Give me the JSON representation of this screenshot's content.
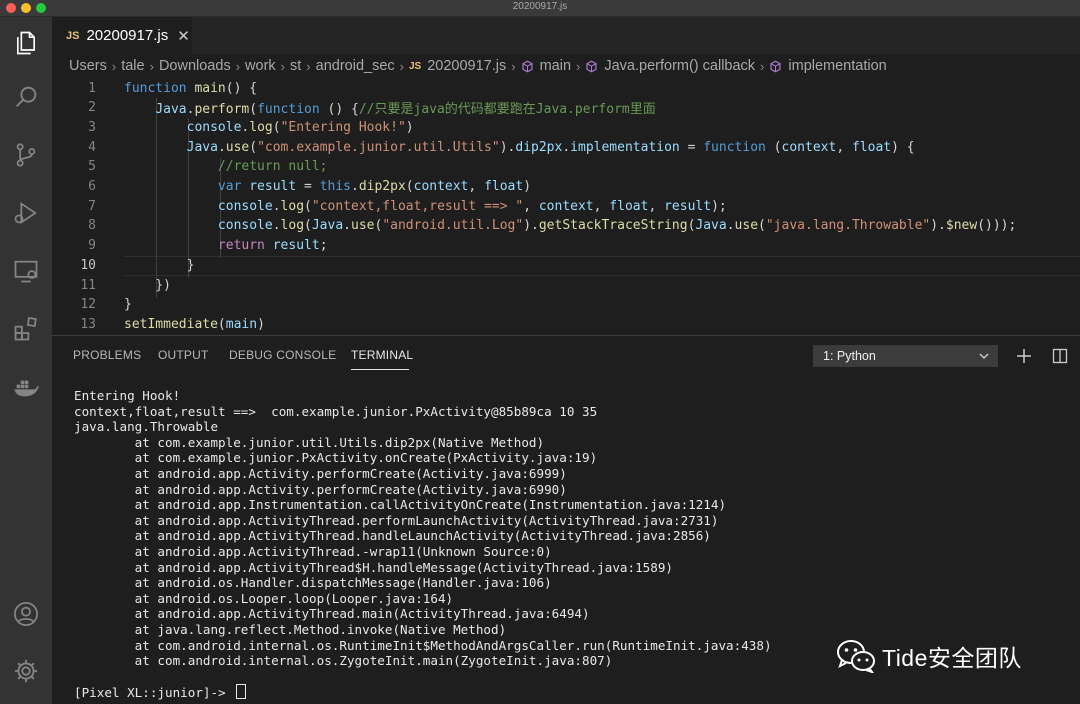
{
  "window": {
    "title": "20200917.js"
  },
  "activity_bar": {
    "icons": [
      "files-icon",
      "search-icon",
      "source-control-icon",
      "run-debug-icon",
      "remote-explorer-icon",
      "extensions-icon",
      "docker-icon",
      "account-icon",
      "settings-gear-icon"
    ]
  },
  "tab": {
    "badge": "JS",
    "name": "20200917.js",
    "close": "✕"
  },
  "breadcrumb": {
    "items": [
      "Users",
      "tale",
      "Downloads",
      "work",
      "st",
      "android_sec"
    ],
    "file_badge": "JS",
    "file": "20200917.js",
    "symbols": [
      "main",
      "Java.perform() callback",
      "implementation"
    ]
  },
  "editor": {
    "current_line": 10,
    "lines": [
      {
        "n": "1",
        "tokens": [
          [
            "k",
            "function"
          ],
          [
            "p",
            " "
          ],
          [
            "f",
            "main"
          ],
          [
            "p",
            "() {"
          ]
        ]
      },
      {
        "n": "2",
        "tokens": [
          [
            "p",
            "    "
          ],
          [
            "v",
            "Java"
          ],
          [
            "p",
            "."
          ],
          [
            "f",
            "perform"
          ],
          [
            "p",
            "("
          ],
          [
            "k",
            "function"
          ],
          [
            "p",
            " () {"
          ],
          [
            "c",
            "//只要是java的代码都要跑在Java.perform里面"
          ]
        ]
      },
      {
        "n": "3",
        "tokens": [
          [
            "p",
            "        "
          ],
          [
            "v",
            "console"
          ],
          [
            "p",
            "."
          ],
          [
            "f",
            "log"
          ],
          [
            "p",
            "("
          ],
          [
            "s",
            "\"Entering Hook!\""
          ],
          [
            "p",
            ")"
          ]
        ]
      },
      {
        "n": "4",
        "tokens": [
          [
            "p",
            "        "
          ],
          [
            "v",
            "Java"
          ],
          [
            "p",
            "."
          ],
          [
            "f",
            "use"
          ],
          [
            "p",
            "("
          ],
          [
            "s",
            "\"com.example.junior.util.Utils\""
          ],
          [
            "p",
            ")."
          ],
          [
            "v",
            "dip2px"
          ],
          [
            "p",
            "."
          ],
          [
            "v",
            "implementation"
          ],
          [
            "p",
            " = "
          ],
          [
            "k",
            "function"
          ],
          [
            "p",
            " ("
          ],
          [
            "v",
            "context"
          ],
          [
            "p",
            ", "
          ],
          [
            "v",
            "float"
          ],
          [
            "p",
            ") {"
          ]
        ]
      },
      {
        "n": "5",
        "tokens": [
          [
            "p",
            "            "
          ],
          [
            "c",
            "//return null;"
          ]
        ]
      },
      {
        "n": "6",
        "tokens": [
          [
            "p",
            "            "
          ],
          [
            "k",
            "var"
          ],
          [
            "p",
            " "
          ],
          [
            "v",
            "result"
          ],
          [
            "p",
            " = "
          ],
          [
            "k",
            "this"
          ],
          [
            "p",
            "."
          ],
          [
            "f",
            "dip2px"
          ],
          [
            "p",
            "("
          ],
          [
            "v",
            "context"
          ],
          [
            "p",
            ", "
          ],
          [
            "v",
            "float"
          ],
          [
            "p",
            ")"
          ]
        ]
      },
      {
        "n": "7",
        "tokens": [
          [
            "p",
            "            "
          ],
          [
            "v",
            "console"
          ],
          [
            "p",
            "."
          ],
          [
            "f",
            "log"
          ],
          [
            "p",
            "("
          ],
          [
            "s",
            "\"context,float,result ==> \""
          ],
          [
            "p",
            ", "
          ],
          [
            "v",
            "context"
          ],
          [
            "p",
            ", "
          ],
          [
            "v",
            "float"
          ],
          [
            "p",
            ", "
          ],
          [
            "v",
            "result"
          ],
          [
            "p",
            ");"
          ]
        ]
      },
      {
        "n": "8",
        "tokens": [
          [
            "p",
            "            "
          ],
          [
            "v",
            "console"
          ],
          [
            "p",
            "."
          ],
          [
            "f",
            "log"
          ],
          [
            "p",
            "("
          ],
          [
            "v",
            "Java"
          ],
          [
            "p",
            "."
          ],
          [
            "f",
            "use"
          ],
          [
            "p",
            "("
          ],
          [
            "s",
            "\"android.util.Log\""
          ],
          [
            "p",
            ")."
          ],
          [
            "f",
            "getStackTraceString"
          ],
          [
            "p",
            "("
          ],
          [
            "v",
            "Java"
          ],
          [
            "p",
            "."
          ],
          [
            "f",
            "use"
          ],
          [
            "p",
            "("
          ],
          [
            "s",
            "\"java.lang.Throwable\""
          ],
          [
            "p",
            ")."
          ],
          [
            "f",
            "$new"
          ],
          [
            "p",
            "()));"
          ]
        ]
      },
      {
        "n": "9",
        "tokens": [
          [
            "p",
            "            "
          ],
          [
            "kw2",
            "return"
          ],
          [
            "p",
            " "
          ],
          [
            "v",
            "result"
          ],
          [
            "p",
            ";"
          ]
        ]
      },
      {
        "n": "10",
        "tokens": [
          [
            "p",
            "        }"
          ]
        ]
      },
      {
        "n": "11",
        "tokens": [
          [
            "p",
            "    })"
          ]
        ]
      },
      {
        "n": "12",
        "tokens": [
          [
            "p",
            "}"
          ]
        ]
      },
      {
        "n": "13",
        "tokens": [
          [
            "f",
            "setImmediate"
          ],
          [
            "p",
            "("
          ],
          [
            "v",
            "main"
          ],
          [
            "p",
            ")"
          ]
        ]
      }
    ]
  },
  "panel": {
    "tabs": [
      "PROBLEMS",
      "OUTPUT",
      "DEBUG CONSOLE",
      "TERMINAL"
    ],
    "active_tab": "TERMINAL",
    "terminal_select": "1: Python",
    "add_label": "+",
    "split_label": "split-terminal-icon"
  },
  "terminal": {
    "lines": [
      "Entering Hook!",
      "context,float,result ==>  com.example.junior.PxActivity@85b89ca 10 35",
      "java.lang.Throwable",
      "        at com.example.junior.util.Utils.dip2px(Native Method)",
      "        at com.example.junior.PxActivity.onCreate(PxActivity.java:19)",
      "        at android.app.Activity.performCreate(Activity.java:6999)",
      "        at android.app.Activity.performCreate(Activity.java:6990)",
      "        at android.app.Instrumentation.callActivityOnCreate(Instrumentation.java:1214)",
      "        at android.app.ActivityThread.performLaunchActivity(ActivityThread.java:2731)",
      "        at android.app.ActivityThread.handleLaunchActivity(ActivityThread.java:2856)",
      "        at android.app.ActivityThread.-wrap11(Unknown Source:0)",
      "        at android.app.ActivityThread$H.handleMessage(ActivityThread.java:1589)",
      "        at android.os.Handler.dispatchMessage(Handler.java:106)",
      "        at android.os.Looper.loop(Looper.java:164)",
      "        at android.app.ActivityThread.main(ActivityThread.java:6494)",
      "        at java.lang.reflect.Method.invoke(Native Method)",
      "        at com.android.internal.os.RuntimeInit$MethodAndArgsCaller.run(RuntimeInit.java:438)",
      "        at com.android.internal.os.ZygoteInit.main(ZygoteInit.java:807)"
    ],
    "prompt": "[Pixel XL::junior]-> "
  },
  "watermark": {
    "text": "Tide安全团队",
    "icon": "wechat-icon"
  }
}
